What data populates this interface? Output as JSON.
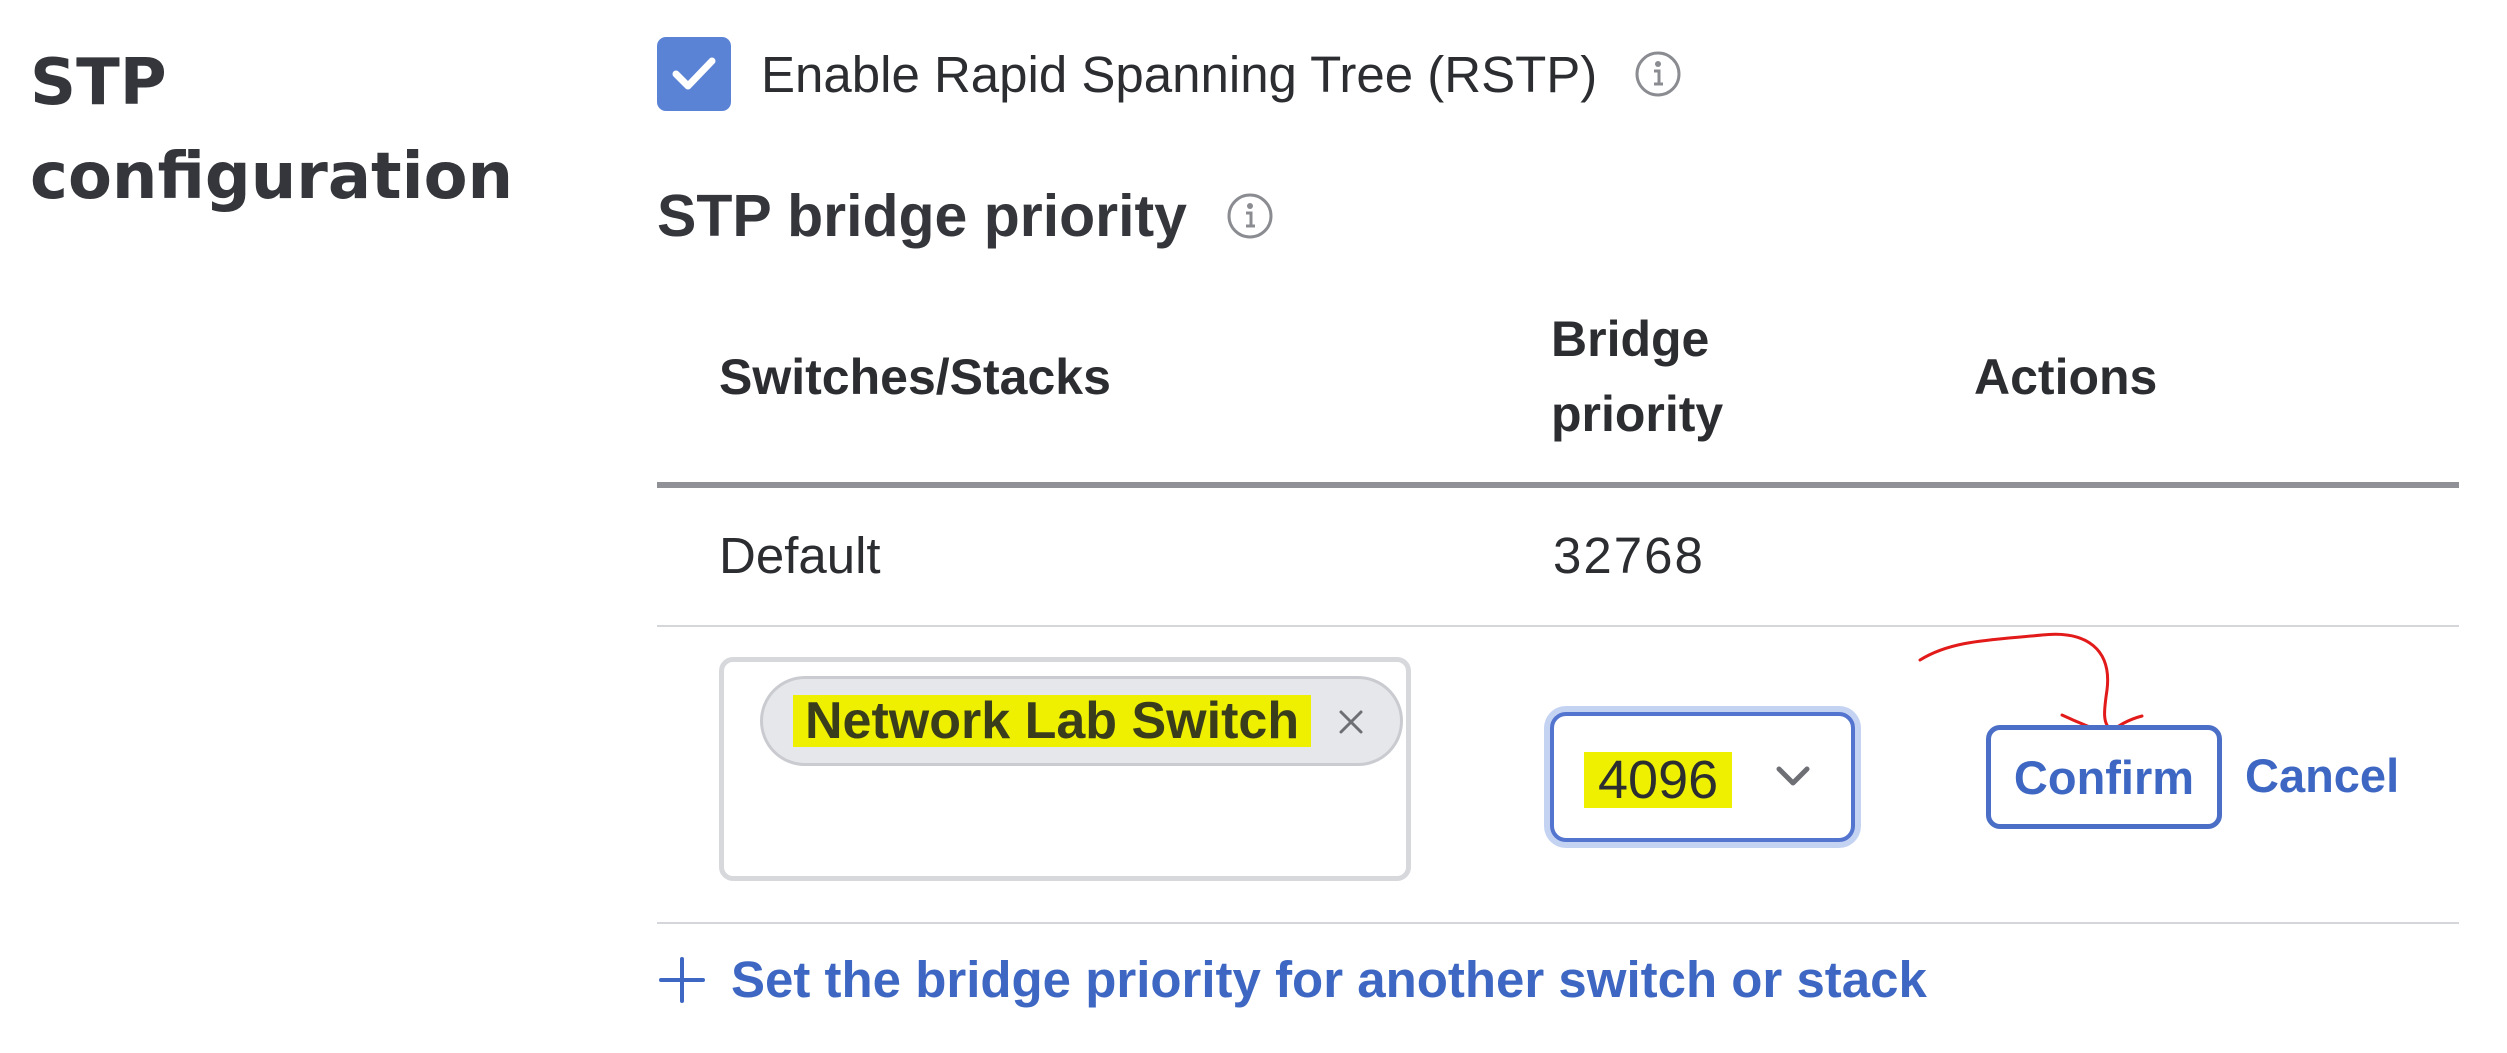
{
  "section": {
    "title_line1": "STP",
    "title_line2": "configuration"
  },
  "rstp": {
    "checked": true,
    "label": "Enable Rapid Spanning Tree (RSTP)",
    "info_icon": "info-icon"
  },
  "bridge_priority": {
    "heading": "STP bridge priority",
    "info_icon": "info-icon"
  },
  "table": {
    "headers": {
      "switches": "Switches/Stacks",
      "priority_line1": "Bridge",
      "priority_line2": "priority",
      "actions": "Actions"
    },
    "rows": [
      {
        "switch": "Default",
        "priority": "32768"
      }
    ],
    "edit_row": {
      "selected_switch": "Network Lab Switch",
      "priority_value": "4096",
      "confirm_label": "Confirm",
      "cancel_label": "Cancel"
    }
  },
  "add_link": {
    "label": "Set the bridge priority for another switch or stack",
    "icon": "plus-icon"
  },
  "colors": {
    "accent": "#3d67c2",
    "checkbox": "#5a83d6",
    "highlight": "#eef000",
    "annotation": "#e21a1a"
  }
}
